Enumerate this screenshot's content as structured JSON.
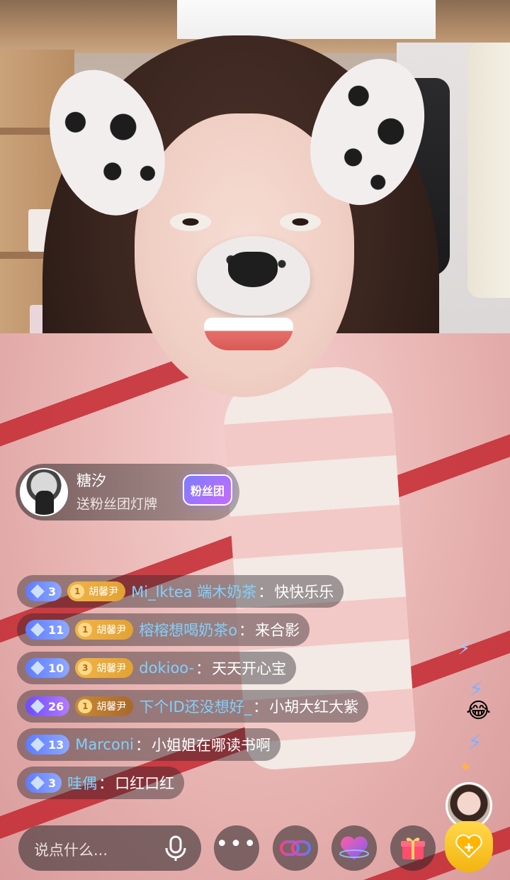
{
  "notification": {
    "user_name": "糖汐",
    "action": "送粉丝团灯牌",
    "badge_label": "粉丝团"
  },
  "chat_messages": [
    {
      "level": "3",
      "level_style": "blue",
      "club_level": "1",
      "club_name": "胡馨尹",
      "club_style": "gold",
      "user": "Mi_lktea 端木奶茶",
      "text": "快快乐乐"
    },
    {
      "level": "11",
      "level_style": "blue",
      "club_level": "1",
      "club_name": "胡馨尹",
      "club_style": "gold",
      "user": "榕榕想喝奶茶o",
      "text": "来合影"
    },
    {
      "level": "10",
      "level_style": "blue",
      "club_level": "3",
      "club_name": "胡馨尹",
      "club_style": "gold",
      "user": "dokioo-",
      "text": "天天开心宝"
    },
    {
      "level": "26",
      "level_style": "purple",
      "club_level": "1",
      "club_name": "胡馨尹",
      "club_style": "brown",
      "user": "下个ID还没想好_",
      "text": "小胡大红大紫"
    },
    {
      "level": "13",
      "level_style": "blue",
      "user": "Marconi",
      "text": "小姐姐在哪读书啊"
    },
    {
      "level": "3",
      "level_style": "blue",
      "user": "哇偶",
      "text": "口红口红"
    }
  ],
  "colon": "：",
  "bottom_bar": {
    "input_placeholder": "说点什么...",
    "icons": [
      "mic-icon",
      "more-icon",
      "link-mic-icon",
      "heart-icon",
      "gift-icon",
      "fan-club-icon"
    ]
  },
  "colors": {
    "username": "#7fd1ff",
    "level_blue": "#5d7cff",
    "level_purple": "#6c4cff",
    "club_gold": "#f0b447",
    "fan_button": "#ffd84a"
  }
}
